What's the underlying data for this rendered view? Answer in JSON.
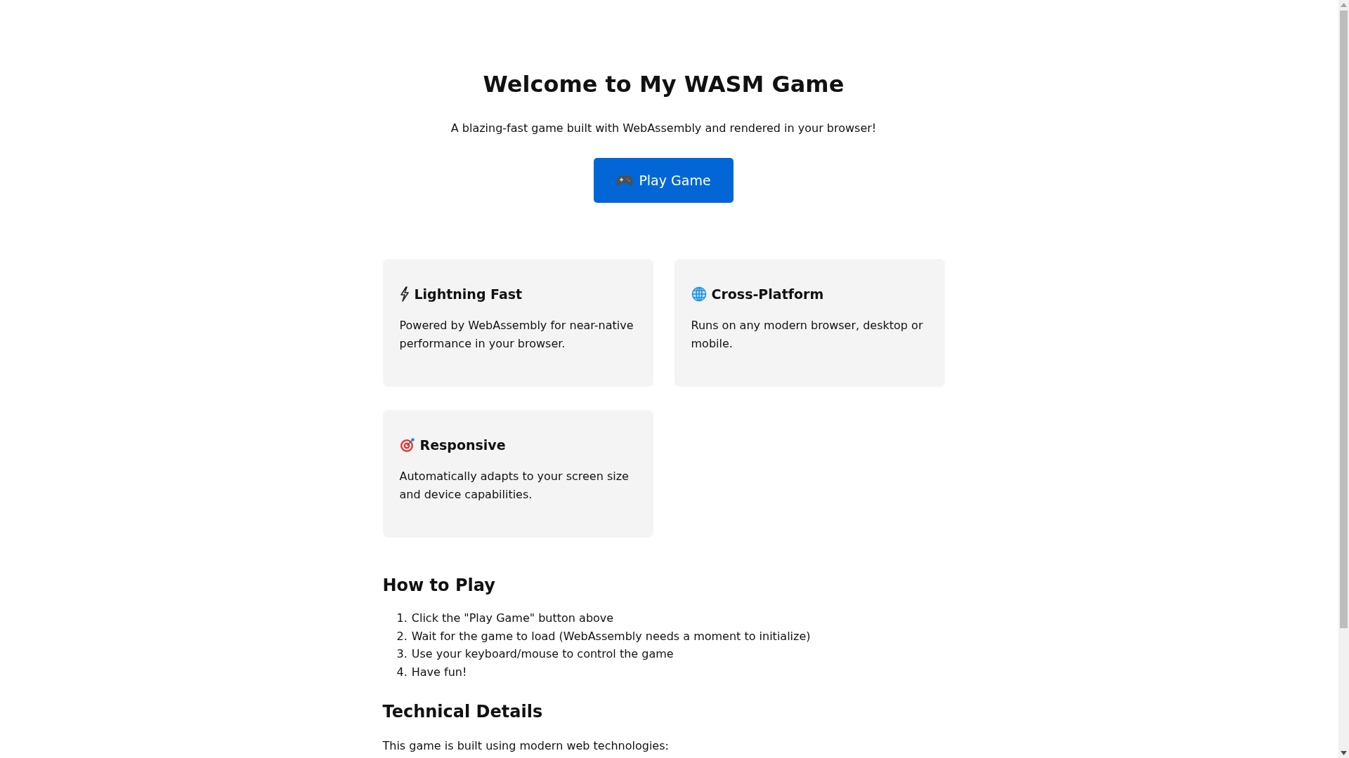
{
  "header": {
    "title": "Welcome to My WASM Game",
    "tagline": "A blazing-fast game built with WebAssembly and rendered in your browser!",
    "play_button": "Play Game"
  },
  "features": [
    {
      "kind": "lightning",
      "title": "Lightning Fast",
      "text": "Powered by WebAssembly for near-native performance in your browser."
    },
    {
      "kind": "globe",
      "title": "Cross-Platform",
      "text": "Runs on any modern browser, desktop or mobile."
    },
    {
      "kind": "target",
      "title": "Responsive",
      "text": "Automatically adapts to your screen size and device capabilities."
    }
  ],
  "how_to_play": {
    "heading": "How to Play",
    "steps": [
      {
        "number": "1.",
        "text": "Click the \"Play Game\" button above"
      },
      {
        "number": "2.",
        "text": "Wait for the game to load (WebAssembly needs a moment to initialize)"
      },
      {
        "number": "3.",
        "text": "Use your keyboard/mouse to control the game"
      },
      {
        "number": "4.",
        "text": "Have fun!"
      }
    ]
  },
  "technical_details": {
    "heading": "Technical Details",
    "intro": "This game is built using modern web technologies:"
  }
}
